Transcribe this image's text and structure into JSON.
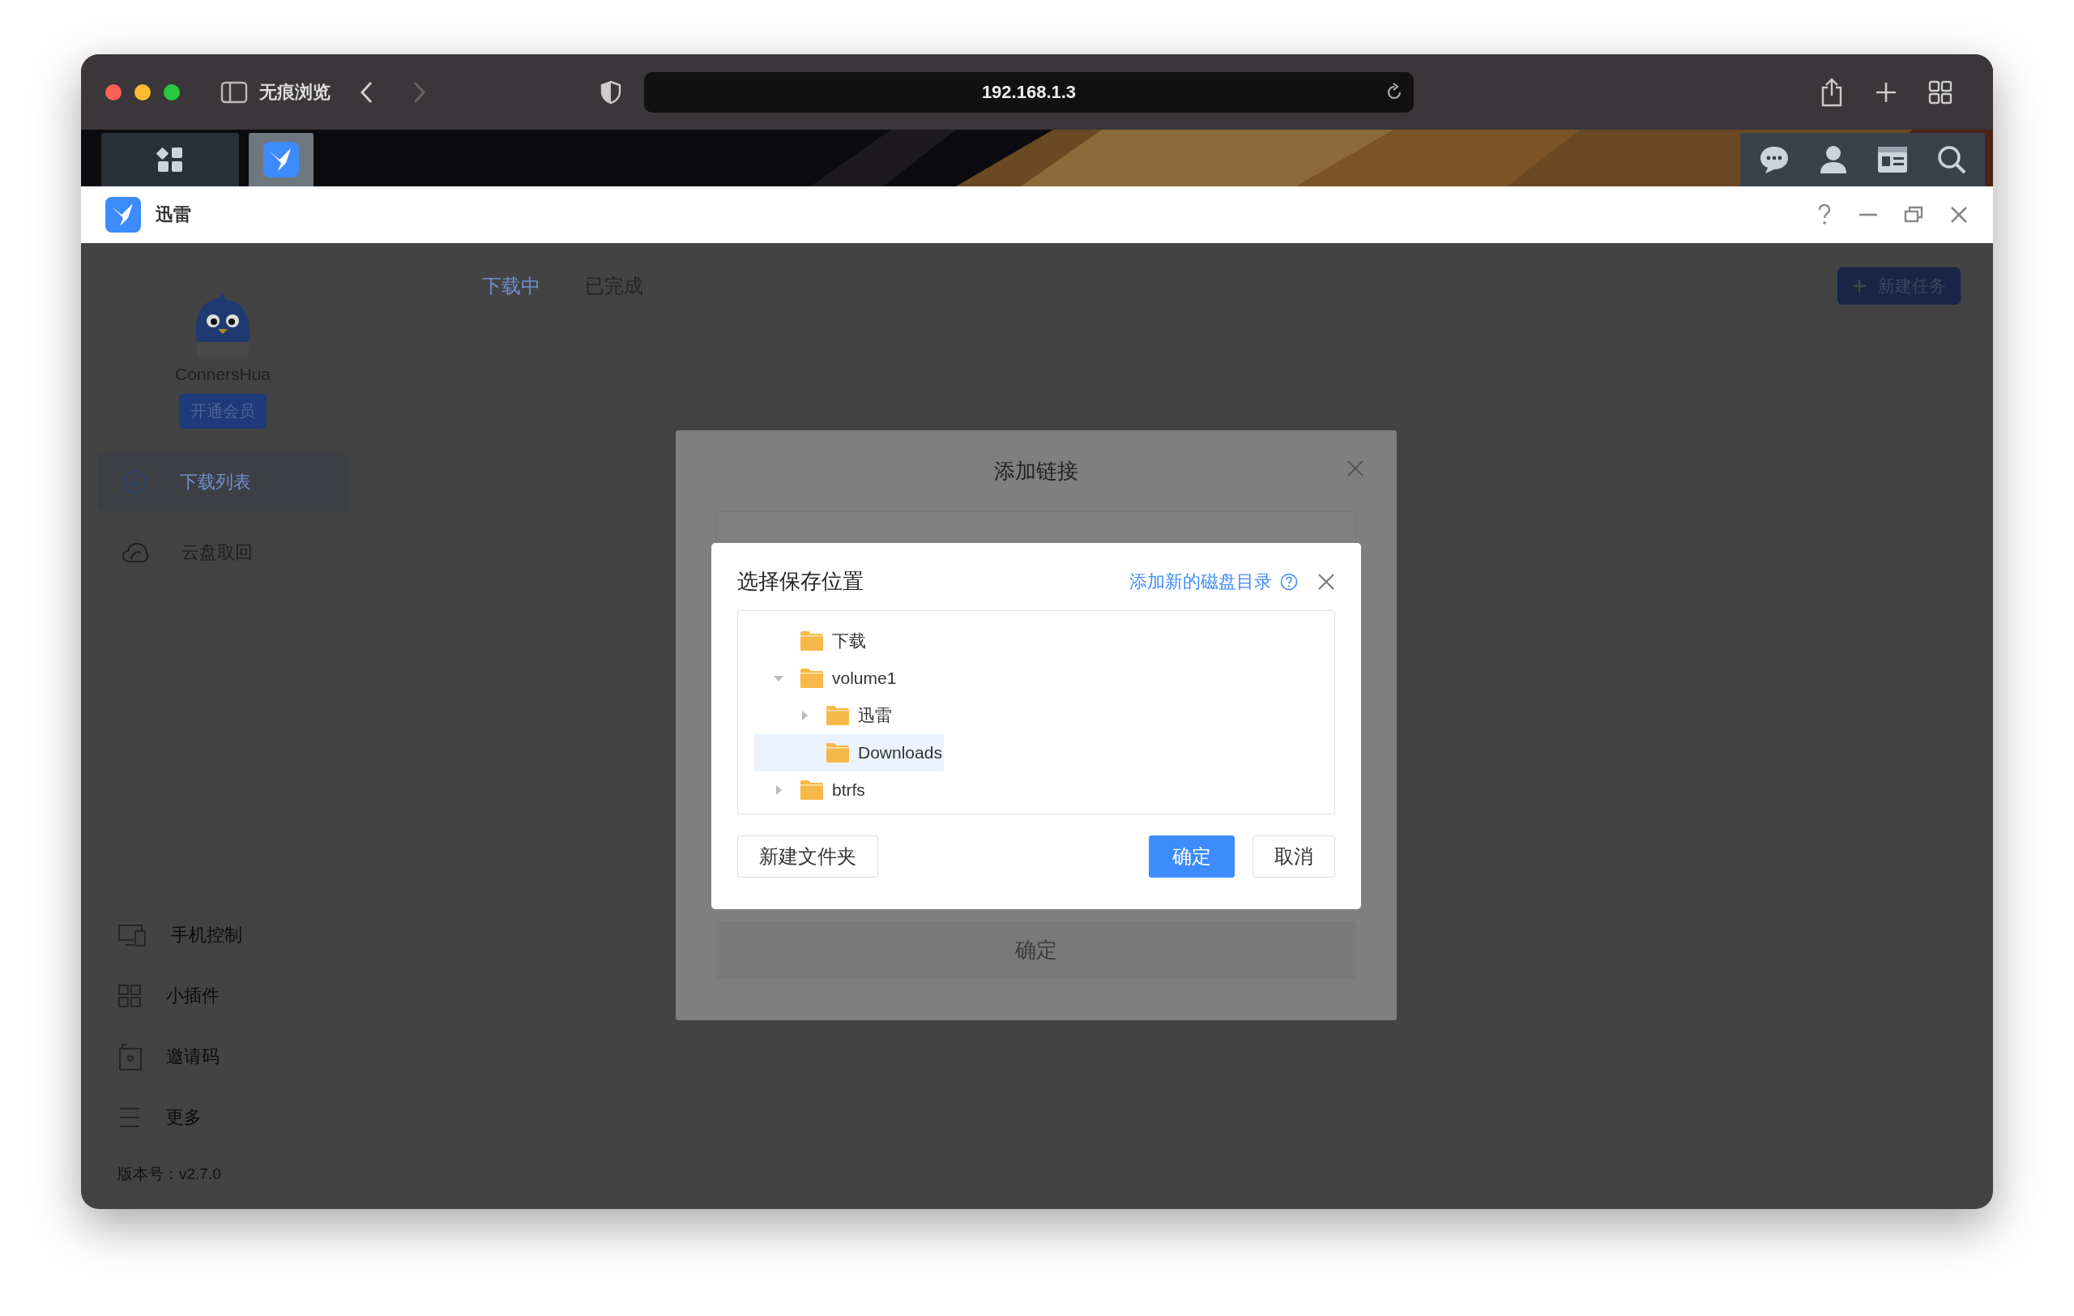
{
  "browser": {
    "private_label": "无痕浏览",
    "address": "192.168.1.3"
  },
  "taskbar": {
    "tiles": [
      {
        "kind": "apps",
        "selected": false
      },
      {
        "kind": "bird",
        "selected": true
      }
    ],
    "tools": [
      {
        "kind": "chat"
      },
      {
        "kind": "user"
      },
      {
        "kind": "card"
      },
      {
        "kind": "search"
      }
    ]
  },
  "app_window": {
    "title": "迅雷"
  },
  "sidebar": {
    "username": "ConnersHua",
    "vip_button": "开通会员",
    "items": [
      {
        "label": "下载列表",
        "kind": "download",
        "selected": true
      },
      {
        "label": "云盘取回",
        "kind": "cloud",
        "selected": false
      }
    ],
    "bottom_items": [
      {
        "label": "手机控制",
        "kind": "devices"
      },
      {
        "label": "小插件",
        "kind": "widgets"
      },
      {
        "label": "邀请码",
        "kind": "invite"
      },
      {
        "label": "更多",
        "kind": "menu"
      }
    ],
    "version": "版本号：v2.7.0"
  },
  "tabs": [
    {
      "label": "下载中",
      "selected": true
    },
    {
      "label": "已完成",
      "selected": false
    }
  ],
  "new_task_button": "新建任务",
  "add_link_dialog": {
    "title": "添加链接",
    "confirm_button": "确定"
  },
  "save_location_dialog": {
    "title": "选择保存位置",
    "add_disk_link": "添加新的磁盘目录",
    "tree": [
      {
        "label": "下载",
        "selected": false
      },
      {
        "label": "volume1",
        "selected": false,
        "expanded": true,
        "children": [
          {
            "label": "迅雷",
            "selected": false,
            "expanded": false
          },
          {
            "label": "Downloads",
            "selected": true
          }
        ]
      },
      {
        "label": "btrfs",
        "selected": false,
        "expanded": false
      }
    ],
    "new_folder_button": "新建文件夹",
    "ok_button": "确定",
    "cancel_button": "取消"
  }
}
